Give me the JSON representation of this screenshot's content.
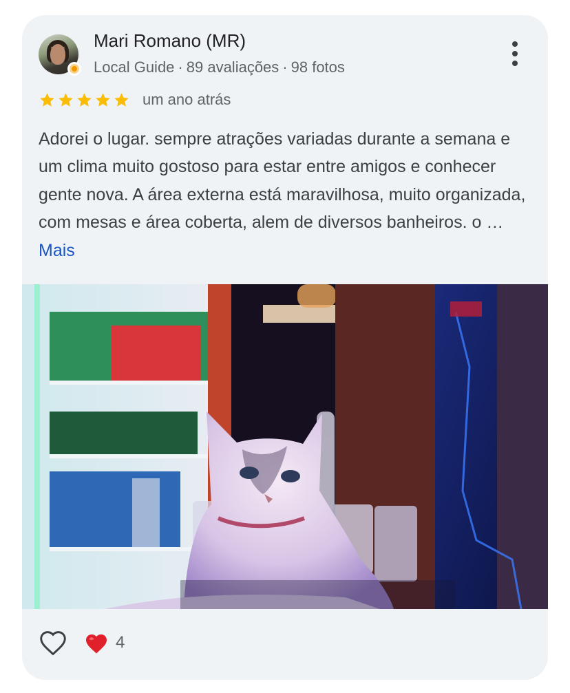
{
  "review": {
    "author": {
      "name": "Mari Romano (MR)",
      "badge": "Local Guide",
      "reviews_count": "89 avaliações",
      "photos_count": "98 fotos",
      "separator": "·",
      "avatar_icon": "profile-photo",
      "badge_icon": "local-guide-badge-icon"
    },
    "more_options_icon": "more-vert-icon",
    "rating": 5,
    "rating_max": 5,
    "date": "um ano atrás",
    "text": "Adorei o lugar. sempre atrações variadas durante a semana e um clima muito gostoso para estar entre amigos e conhecer gente nova. A área externa está maravilhosa, muito organizada, com mesas e área coberta, alem de diversos banheiros. o …",
    "more_link": "Mais",
    "photo_icon": "review-photo",
    "reactions": {
      "like_icon": "heart-outline-icon",
      "reaction_icon": "red-heart-icon",
      "count": "4"
    }
  },
  "colors": {
    "card_bg": "#f0f3f6",
    "star": "#fbbc04",
    "link": "#1a56c4",
    "heart": "#e0212c",
    "text": "#3c4043",
    "muted": "#5f6368"
  }
}
